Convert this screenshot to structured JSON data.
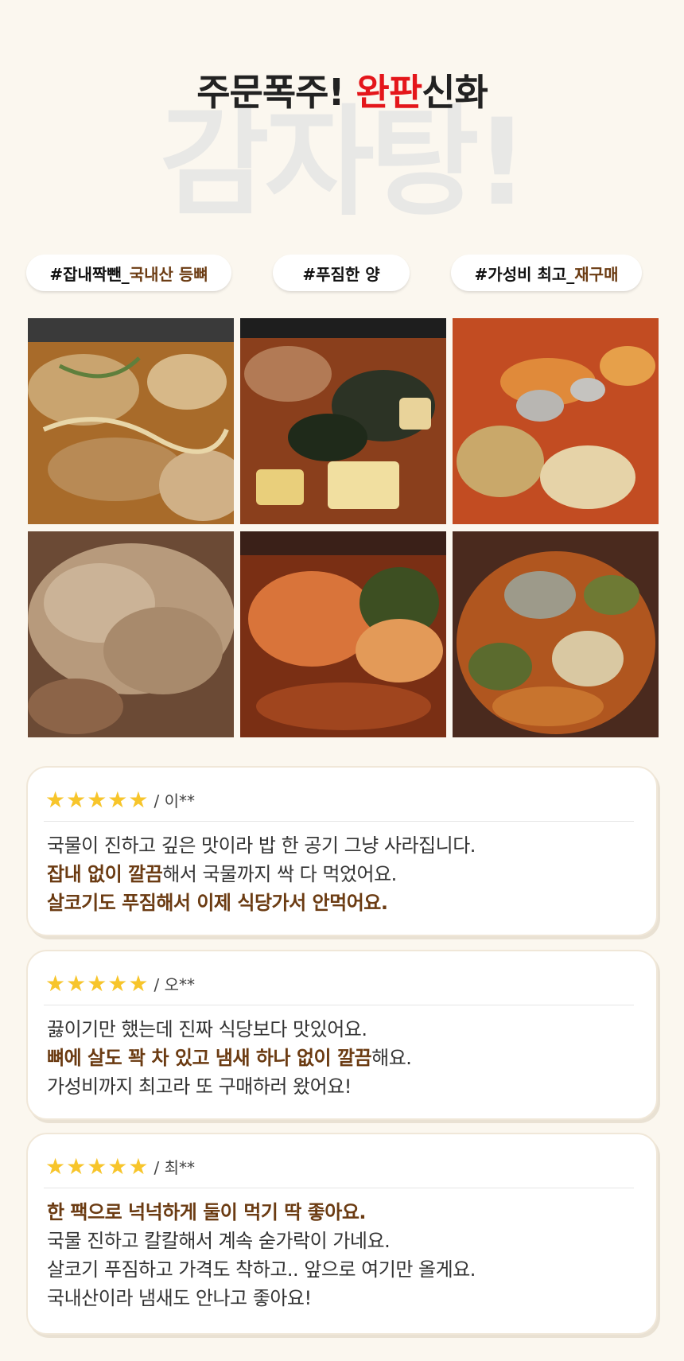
{
  "hero": {
    "headline_prefix": "주문폭주! ",
    "headline_accent": "완판",
    "headline_suffix": "신화",
    "background_word": "감자탕!",
    "accent_color": "#e4161b"
  },
  "tags": [
    {
      "main": "#잡내짝뺀_",
      "highlight": "국내산 등뼈"
    },
    {
      "main": "#푸짐한 양",
      "highlight": ""
    },
    {
      "main": "#가성비 최고_",
      "highlight": "재구매"
    }
  ],
  "gallery": {
    "photos": [
      {
        "icon": "stew-photo"
      },
      {
        "icon": "stew-photo"
      },
      {
        "icon": "stew-photo"
      },
      {
        "icon": "stew-photo"
      },
      {
        "icon": "stew-photo"
      },
      {
        "icon": "stew-photo"
      }
    ]
  },
  "reviews": [
    {
      "stars": "★★★★★",
      "rating": 5,
      "reviewer": "/ 이**",
      "lines": [
        {
          "bold": "",
          "text": "국물이 진하고 깊은 맛이라 밥 한 공기 그냥 사라집니다."
        },
        {
          "bold": "잡내 없이 깔끔",
          "text": "해서 국물까지 싹 다 먹었어요."
        },
        {
          "bold": "살코기도 푸짐해서 이제 식당가서 안먹어요.",
          "text": ""
        }
      ]
    },
    {
      "stars": "★★★★★",
      "rating": 5,
      "reviewer": "/ 오**",
      "lines": [
        {
          "bold": "",
          "text": "끓이기만 했는데 진짜 식당보다 맛있어요."
        },
        {
          "bold": "뼈에 살도 꽉 차 있고 냄새 하나 없이 깔끔",
          "text": "해요."
        },
        {
          "bold": "",
          "text": "가성비까지 최고라 또 구매하러 왔어요!"
        }
      ]
    },
    {
      "stars": "★★★★★",
      "rating": 5,
      "reviewer": "/ 최**",
      "lines": [
        {
          "bold": "한 팩으로 넉넉하게 둘이 먹기 딱 좋아요.",
          "text": ""
        },
        {
          "bold": "",
          "text": "국물 진하고 칼칼해서 계속 숟가락이 가네요."
        },
        {
          "bold": "",
          "text": "살코기 푸짐하고 가격도 착하고.. 앞으로 여기만 올게요."
        },
        {
          "bold": "",
          "text": "국내산이라 냄새도 안나고 좋아요!"
        }
      ]
    }
  ]
}
